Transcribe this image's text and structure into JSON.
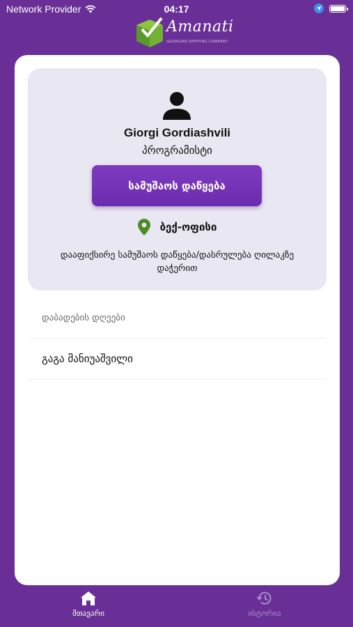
{
  "status_bar": {
    "carrier": "Network Provider",
    "time": "04:17"
  },
  "logo": {
    "name": "Amanati",
    "subtitle": "GEORGIAN SHIPPING COMPANY"
  },
  "profile": {
    "name": "Giorgi Gordiashvili",
    "role": "პროგრამისტი",
    "start_button": "სამუშაოს დაწყება",
    "location": "ბექ-ოფისი",
    "hint": "დააფიქსირე სამუშაოს დაწყება/დასრულება ღილაკზე დაჭერით"
  },
  "birthdays": {
    "header": "დაბადების დღეები",
    "items": [
      "გაგა მანიუაშვილი"
    ]
  },
  "tabs": [
    {
      "label": "მთავარი",
      "icon": "home-icon",
      "active": true
    },
    {
      "label": "ისტორია",
      "icon": "history-icon",
      "active": false
    }
  ],
  "colors": {
    "background": "#6a2f96",
    "button": "#7435b8",
    "location_pin": "#4a8c2a",
    "inactive_tab": "#a88cc8"
  }
}
